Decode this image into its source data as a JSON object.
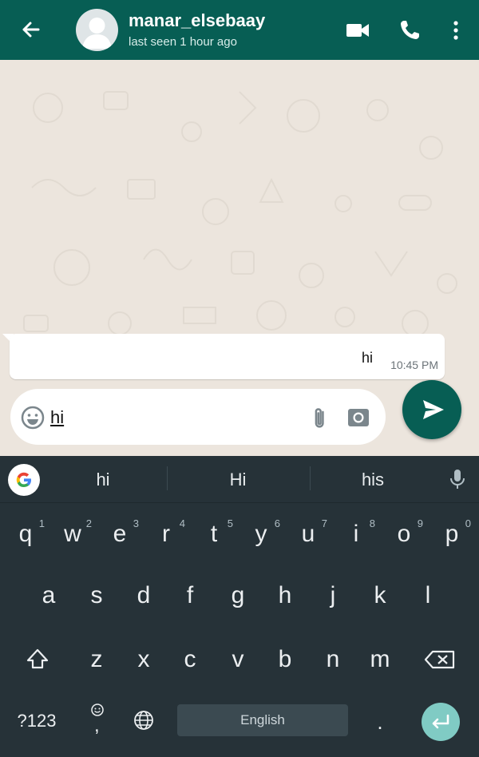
{
  "header": {
    "title": "manar_elsebaay",
    "subtitle": "last seen 1 hour ago",
    "icons": [
      "back-arrow-icon",
      "avatar",
      "video-call-icon",
      "phone-icon",
      "more-vert-icon"
    ]
  },
  "message": {
    "text": "hi",
    "time": "10:45 PM"
  },
  "composer": {
    "value": "hi",
    "icons": [
      "emoji-icon",
      "attach-icon",
      "camera-icon",
      "send-icon"
    ]
  },
  "keyboard": {
    "suggestions": [
      "hi",
      "Hi",
      "his"
    ],
    "row1": [
      {
        "label": "q",
        "num": "1"
      },
      {
        "label": "w",
        "num": "2"
      },
      {
        "label": "e",
        "num": "3"
      },
      {
        "label": "r",
        "num": "4"
      },
      {
        "label": "t",
        "num": "5"
      },
      {
        "label": "y",
        "num": "6"
      },
      {
        "label": "u",
        "num": "7"
      },
      {
        "label": "i",
        "num": "8"
      },
      {
        "label": "o",
        "num": "9"
      },
      {
        "label": "p",
        "num": "0"
      }
    ],
    "row2": [
      "a",
      "s",
      "d",
      "f",
      "g",
      "h",
      "j",
      "k",
      "l"
    ],
    "row3": [
      "z",
      "x",
      "c",
      "v",
      "b",
      "n",
      "m"
    ],
    "symbols_label": "?123",
    "comma_label": ",",
    "space_label": "English",
    "period_label": "."
  },
  "colors": {
    "header": "#075e54",
    "wallpaper": "#ece5dd",
    "keyboard": "#263238",
    "enter": "#80cbc4"
  }
}
